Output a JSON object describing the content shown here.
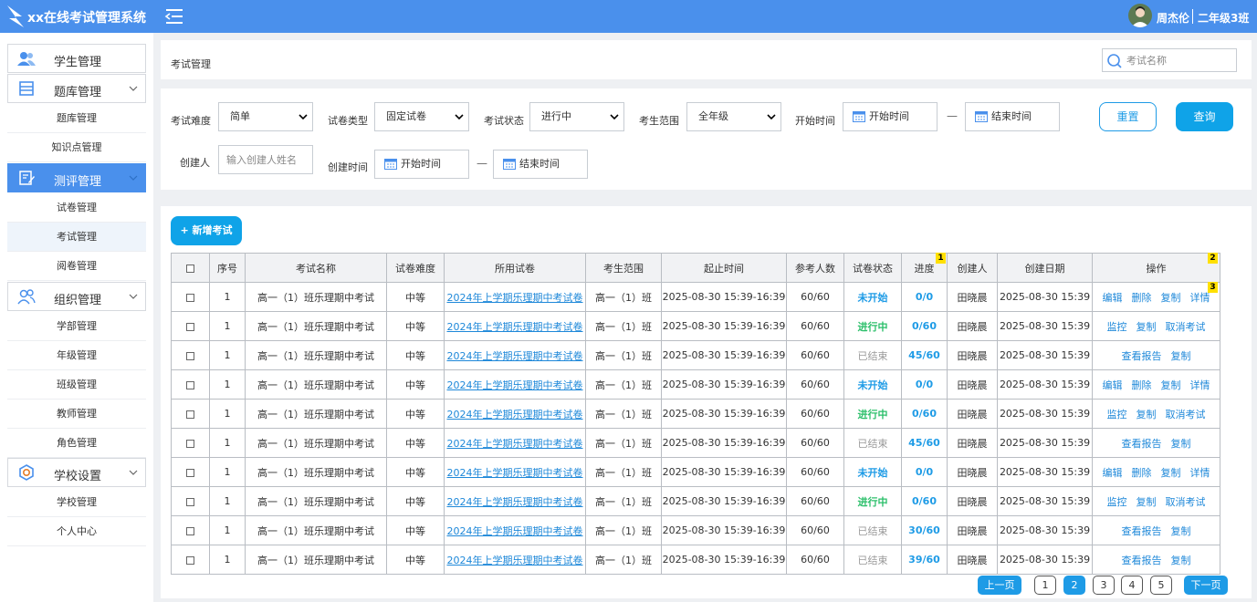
{
  "app": {
    "title": "xx在线考试管理系统",
    "user_name": "周杰伦",
    "user_class": "二年级3班"
  },
  "sidebar": {
    "groups": [
      {
        "label": "学生管理",
        "icon": "users-icon"
      },
      {
        "label": "题库管理",
        "icon": "list-icon"
      },
      {
        "label": "测评管理",
        "icon": "edit-icon"
      },
      {
        "label": "组织管理",
        "icon": "team-icon"
      },
      {
        "label": "学校设置",
        "icon": "settings-icon"
      }
    ],
    "items": [
      "题库管理",
      "知识点管理",
      "试卷管理",
      "考试管理",
      "阅卷管理",
      "学部管理",
      "年级管理",
      "班级管理",
      "教师管理",
      "角色管理",
      "学校管理",
      "个人中心"
    ]
  },
  "page": {
    "breadcrumb": "考试管理",
    "search_placeholder": "考试名称"
  },
  "filters": {
    "difficulty_label": "考试难度",
    "difficulty_value": "简单",
    "paper_type_label": "试卷类型",
    "paper_type_value": "固定试卷",
    "status_label": "考试状态",
    "status_value": "进行中",
    "scope_label": "考生范围",
    "scope_value": "全年级",
    "start_time_label": "开始时间",
    "start_placeholder": "开始时间",
    "end_placeholder": "结束时间",
    "creator_label": "创建人",
    "creator_placeholder": "输入创建人姓名",
    "create_time_label": "创建时间",
    "dash": "—",
    "reset_label": "重置",
    "query_label": "查询"
  },
  "toolbar": {
    "add_label": "+ 新增考试"
  },
  "table": {
    "headers": [
      "",
      "序号",
      "考试名称",
      "试卷难度",
      "所用试卷",
      "考生范围",
      "起止时间",
      "参考人数",
      "试卷状态",
      "进度",
      "创建人",
      "创建日期",
      "操作"
    ],
    "badges": [
      "1",
      "2",
      "3"
    ],
    "rows": [
      {
        "no": "1",
        "name": "高一（1）班乐理期中考试",
        "level": "中等",
        "paper": "2024年上学期乐理期中考试卷",
        "scope": "高一（1）班",
        "period": "2025-08-30 15:39-16:39",
        "count": "60/60",
        "status": "未开始",
        "status_type": "ns",
        "progress": "0/0",
        "creator": "田晓晨",
        "date": "2025-08-30 15:39",
        "actions": [
          "编辑",
          "删除",
          "复制",
          "详情"
        ]
      },
      {
        "no": "1",
        "name": "高一（1）班乐理期中考试",
        "level": "中等",
        "paper": "2024年上学期乐理期中考试卷",
        "scope": "高一（1）班",
        "period": "2025-08-30 15:39-16:39",
        "count": "60/60",
        "status": "进行中",
        "status_type": "on",
        "progress": "0/60",
        "creator": "田晓晨",
        "date": "2025-08-30 15:39",
        "actions": [
          "监控",
          "复制",
          "取消考试"
        ]
      },
      {
        "no": "1",
        "name": "高一（1）班乐理期中考试",
        "level": "中等",
        "paper": "2024年上学期乐理期中考试卷",
        "scope": "高一（1）班",
        "period": "2025-08-30 15:39-16:39",
        "count": "60/60",
        "status": "已结束",
        "status_type": "end",
        "progress": "45/60",
        "creator": "田晓晨",
        "date": "2025-08-30 15:39",
        "actions": [
          "查看报告",
          "复制"
        ]
      },
      {
        "no": "1",
        "name": "高一（1）班乐理期中考试",
        "level": "中等",
        "paper": "2024年上学期乐理期中考试卷",
        "scope": "高一（1）班",
        "period": "2025-08-30 15:39-16:39",
        "count": "60/60",
        "status": "未开始",
        "status_type": "ns",
        "progress": "0/0",
        "creator": "田晓晨",
        "date": "2025-08-30 15:39",
        "actions": [
          "编辑",
          "删除",
          "复制",
          "详情"
        ]
      },
      {
        "no": "1",
        "name": "高一（1）班乐理期中考试",
        "level": "中等",
        "paper": "2024年上学期乐理期中考试卷",
        "scope": "高一（1）班",
        "period": "2025-08-30 15:39-16:39",
        "count": "60/60",
        "status": "进行中",
        "status_type": "on",
        "progress": "0/60",
        "creator": "田晓晨",
        "date": "2025-08-30 15:39",
        "actions": [
          "监控",
          "复制",
          "取消考试"
        ]
      },
      {
        "no": "1",
        "name": "高一（1）班乐理期中考试",
        "level": "中等",
        "paper": "2024年上学期乐理期中考试卷",
        "scope": "高一（1）班",
        "period": "2025-08-30 15:39-16:39",
        "count": "60/60",
        "status": "已结束",
        "status_type": "end",
        "progress": "45/60",
        "creator": "田晓晨",
        "date": "2025-08-30 15:39",
        "actions": [
          "查看报告",
          "复制"
        ]
      },
      {
        "no": "1",
        "name": "高一（1）班乐理期中考试",
        "level": "中等",
        "paper": "2024年上学期乐理期中考试卷",
        "scope": "高一（1）班",
        "period": "2025-08-30 15:39-16:39",
        "count": "60/60",
        "status": "未开始",
        "status_type": "ns",
        "progress": "0/0",
        "creator": "田晓晨",
        "date": "2025-08-30 15:39",
        "actions": [
          "编辑",
          "删除",
          "复制",
          "详情"
        ]
      },
      {
        "no": "1",
        "name": "高一（1）班乐理期中考试",
        "level": "中等",
        "paper": "2024年上学期乐理期中考试卷",
        "scope": "高一（1）班",
        "period": "2025-08-30 15:39-16:39",
        "count": "60/60",
        "status": "进行中",
        "status_type": "on",
        "progress": "0/60",
        "creator": "田晓晨",
        "date": "2025-08-30 15:39",
        "actions": [
          "监控",
          "复制",
          "取消考试"
        ]
      },
      {
        "no": "1",
        "name": "高一（1）班乐理期中考试",
        "level": "中等",
        "paper": "2024年上学期乐理期中考试卷",
        "scope": "高一（1）班",
        "period": "2025-08-30 15:39-16:39",
        "count": "60/60",
        "status": "已结束",
        "status_type": "end",
        "progress": "30/60",
        "creator": "田晓晨",
        "date": "2025-08-30 15:39",
        "actions": [
          "查看报告",
          "复制"
        ]
      },
      {
        "no": "1",
        "name": "高一（1）班乐理期中考试",
        "level": "中等",
        "paper": "2024年上学期乐理期中考试卷",
        "scope": "高一（1）班",
        "period": "2025-08-30 15:39-16:39",
        "count": "60/60",
        "status": "已结束",
        "status_type": "end",
        "progress": "39/60",
        "creator": "田晓晨",
        "date": "2025-08-30 15:39",
        "actions": [
          "查看报告",
          "复制"
        ]
      }
    ]
  },
  "pagination": {
    "prev": "上一页",
    "next": "下一页",
    "pages": [
      "1",
      "2",
      "3",
      "4",
      "5"
    ],
    "current": "2"
  },
  "colors": {
    "topbar": "#4a90ec",
    "primary": "#0fa3e8",
    "link": "#1e88d9",
    "running": "#2bbf6a"
  }
}
